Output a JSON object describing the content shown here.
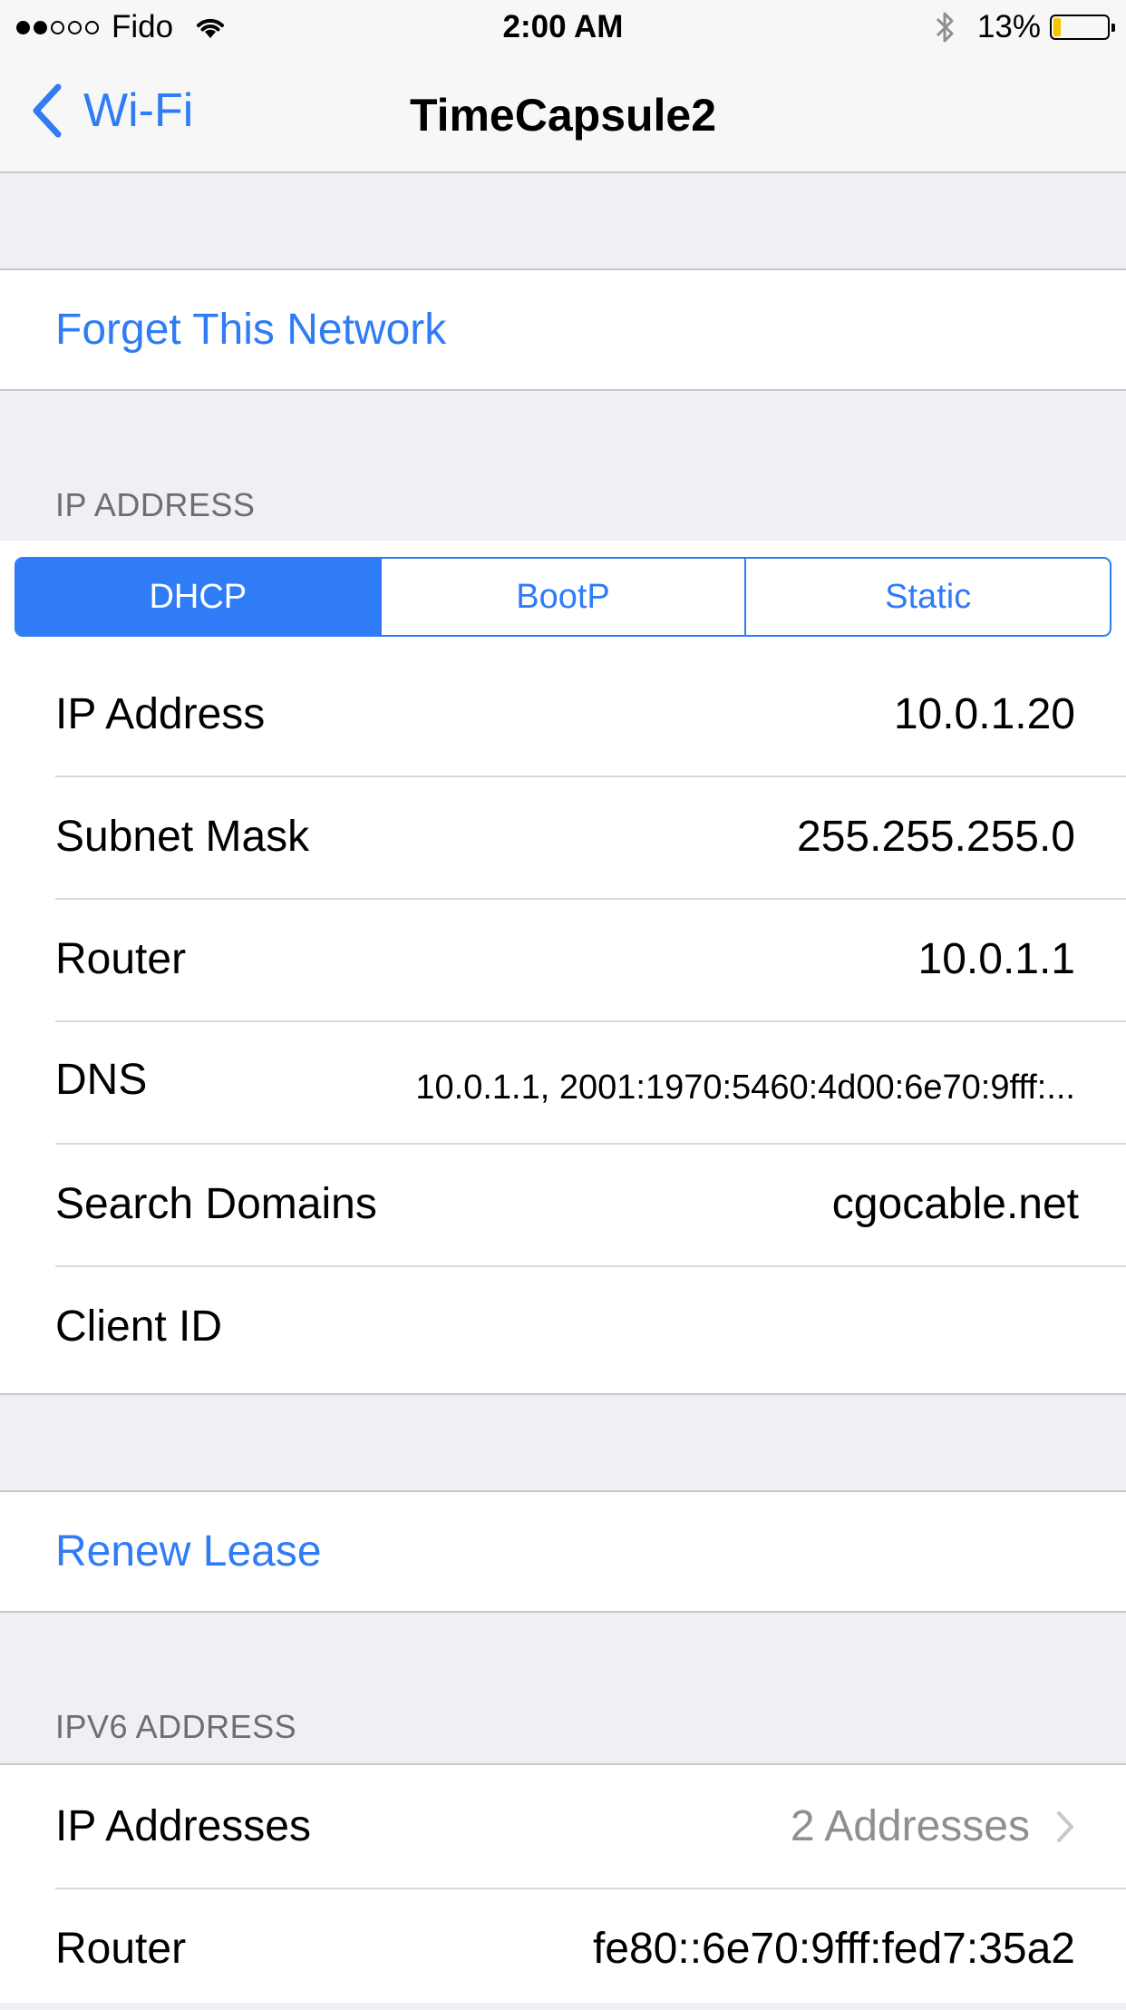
{
  "status_bar": {
    "carrier": "Fido",
    "signal_bars": 2,
    "time": "2:00 AM",
    "battery_percent": "13%",
    "battery_level": 0.13,
    "battery_color": "#f5c500"
  },
  "nav": {
    "back_label": "Wi-Fi",
    "title": "TimeCapsule2"
  },
  "forget_network": "Forget This Network",
  "ip_section": {
    "header": "IP ADDRESS",
    "modes": [
      "DHCP",
      "BootP",
      "Static"
    ],
    "selected_mode": "DHCP",
    "rows": [
      {
        "label": "IP Address",
        "value": "10.0.1.20"
      },
      {
        "label": "Subnet Mask",
        "value": "255.255.255.0"
      },
      {
        "label": "Router",
        "value": "10.0.1.1"
      },
      {
        "label": "DNS",
        "value": "10.0.1.1, 2001:1970:5460:4d00:6e70:9fff:..."
      },
      {
        "label": "Search Domains",
        "value": "cgocable.net"
      },
      {
        "label": "Client ID",
        "value": ""
      }
    ]
  },
  "renew_lease": "Renew Lease",
  "ipv6_section": {
    "header": "IPV6 ADDRESS",
    "rows": [
      {
        "label": "IP Addresses",
        "value": "2 Addresses"
      },
      {
        "label": "Router",
        "value": "fe80::6e70:9fff:fed7:35a2"
      }
    ]
  },
  "colors": {
    "accent": "#2f7cf6",
    "background": "#efeff4",
    "secondary_text": "#8e8e93"
  }
}
